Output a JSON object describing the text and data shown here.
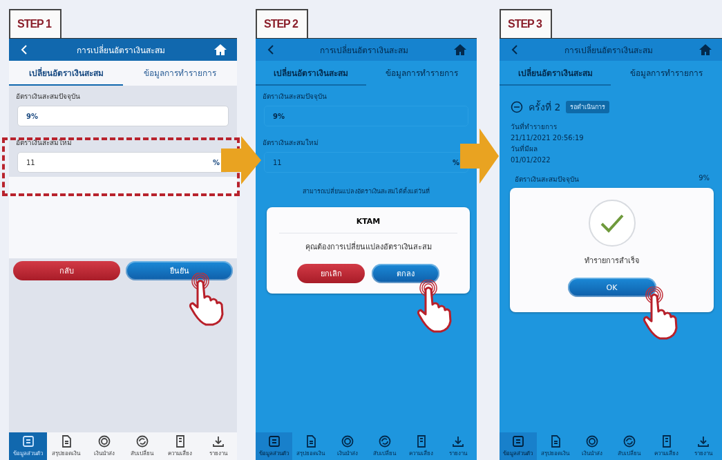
{
  "steps": [
    {
      "label": "STEP 1",
      "dimmed": false,
      "title": "การเปลี่ยนอัตราเงินสะสม",
      "tabs": [
        {
          "label": "เปลี่ยนอัตราเงินสะสม",
          "selected": true
        },
        {
          "label": "ข้อมูลการทำรายการ",
          "selected": false
        }
      ],
      "content": {
        "kind": "form",
        "current_label": "อัตราเงินสะสมปัจจุบัน",
        "current_value": "9%",
        "new_label": "อัตราเงินสะสมใหม่",
        "new_value": "11",
        "unit": "%",
        "highlighted": true,
        "buttons": [
          {
            "label": "กลับ",
            "kind": "secondary",
            "tapped": false
          },
          {
            "label": "ยืนยัน",
            "kind": "primary",
            "tapped": true
          }
        ]
      },
      "nav": [
        {
          "label": "ข้อมูลส่วนตัว",
          "selected": true
        },
        {
          "label": "สรุปยอดเงิน",
          "selected": false
        },
        {
          "label": "เงินนำส่ง",
          "selected": false
        },
        {
          "label": "สับเปลี่ยน",
          "selected": false
        },
        {
          "label": "ความเสี่ยง",
          "selected": false
        },
        {
          "label": "รายงาน",
          "selected": false
        }
      ]
    },
    {
      "label": "STEP 2",
      "dimmed": true,
      "title": "การเปลี่ยนอัตราเงินสะสม",
      "tabs": [
        {
          "label": "เปลี่ยนอัตราเงินสะสม",
          "selected": true
        },
        {
          "label": "ข้อมูลการทำรายการ",
          "selected": false
        }
      ],
      "content": {
        "kind": "form",
        "current_label": "อัตราเงินสะสมปัจจุบัน",
        "current_value": "9%",
        "new_label": "อัตราเงินสะสมใหม่",
        "new_value": "11",
        "unit": "%",
        "note": "สามารถเปลี่ยนแปลงอัตราเงินสะสมได้ตั้งแต่วันที่"
      },
      "dialog": {
        "kind": "confirm",
        "title": "KTAM",
        "message": "คุณต้องการเปลี่ยนแปลงอัตราเงินสะสม",
        "buttons": [
          {
            "label": "ยกเลิก",
            "kind": "secondary",
            "tapped": false
          },
          {
            "label": "ตกลง",
            "kind": "primary",
            "tapped": true
          }
        ]
      },
      "nav": [
        {
          "label": "ข้อมูลส่วนตัว",
          "selected": true
        },
        {
          "label": "สรุปยอดเงิน",
          "selected": false
        },
        {
          "label": "เงินนำส่ง",
          "selected": false
        },
        {
          "label": "สับเปลี่ยน",
          "selected": false
        },
        {
          "label": "ความเสี่ยง",
          "selected": false
        },
        {
          "label": "รายงาน",
          "selected": false
        }
      ]
    },
    {
      "label": "STEP 3",
      "dimmed": true,
      "title": "การเปลี่ยนอัตราเงินสะสม",
      "tabs": [
        {
          "label": "เปลี่ยนอัตราเงินสะสม",
          "selected": true
        },
        {
          "label": "ข้อมูลการทำรายการ",
          "selected": false
        }
      ],
      "content": {
        "kind": "history",
        "title": "ครั้งที่ 2",
        "badge": "รอดำเนินการ",
        "expanded": true,
        "fields": [
          {
            "label": "วันที่ทำรายการ",
            "value": "21/11/2021 20:56:19"
          },
          {
            "label": "วันที่มีผล",
            "value": "01/01/2022"
          }
        ],
        "rate_label": "อัตราเงินสะสมปัจจุบัน",
        "rate_value": "9%"
      },
      "dialog": {
        "kind": "success",
        "message": "ทำรายการสำเร็จ",
        "buttons": [
          {
            "label": "OK",
            "kind": "primary",
            "tapped": true
          }
        ]
      },
      "nav": [
        {
          "label": "ข้อมูลส่วนตัว",
          "selected": true
        },
        {
          "label": "สรุปยอดเงิน",
          "selected": false
        },
        {
          "label": "เงินนำส่ง",
          "selected": false
        },
        {
          "label": "สับเปลี่ยน",
          "selected": false
        },
        {
          "label": "ความเสี่ยง",
          "selected": false
        },
        {
          "label": "รายงาน",
          "selected": false
        }
      ]
    }
  ]
}
